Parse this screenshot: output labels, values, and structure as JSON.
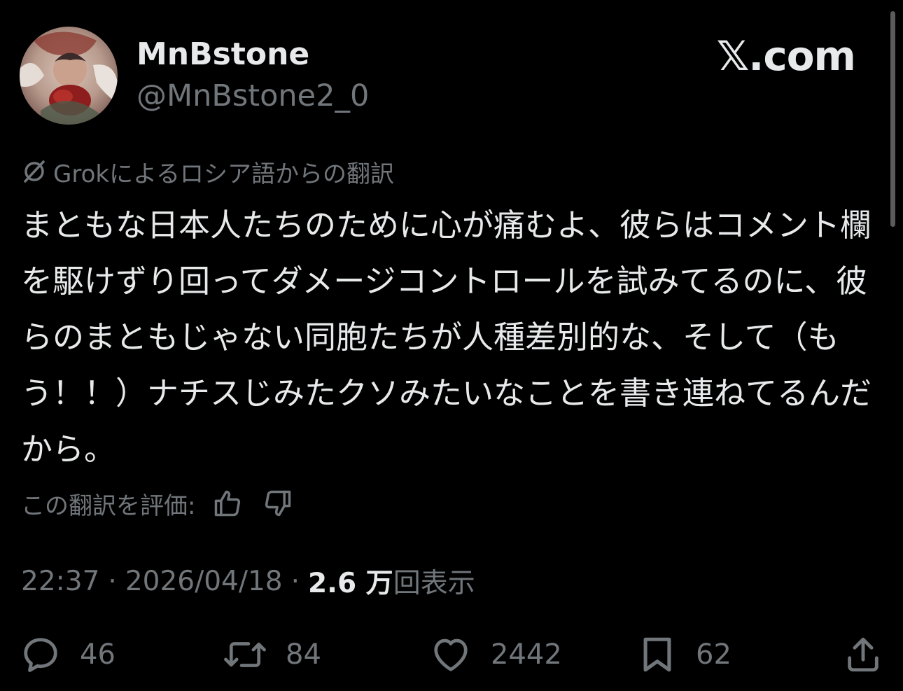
{
  "author": {
    "display_name": "MnBstone",
    "handle": "@MnBstone2_0"
  },
  "brand": "𝕏.com",
  "translation_note": "Grokによるロシア語からの翻訳",
  "tweet_text": "まともな日本人たちのために心が痛むよ、彼らはコメント欄を駆けずり回ってダメージコントロールを試みてるのに、彼らのまともじゃない同胞たちが人種差別的な、そして（もう！！）ナチスじみたクソみたいなことを書き連ねてるんだから。",
  "rate_translation": {
    "label": "この翻訳を評価:"
  },
  "meta": {
    "time": "22:37",
    "separator": "·",
    "date": "2026/04/18",
    "views_count": "2.6 万",
    "views_label": "回表示"
  },
  "actions": {
    "replies": "46",
    "reposts": "84",
    "likes": "2442",
    "bookmarks": "62"
  },
  "icons": {
    "translate": "translate-off-icon",
    "thumbs_up": "thumbs-up-icon",
    "thumbs_down": "thumbs-down-icon",
    "reply": "reply-bubble-icon",
    "repost": "repost-icon",
    "like": "heart-icon",
    "bookmark": "bookmark-icon",
    "share": "share-icon"
  },
  "colors": {
    "background": "#000000",
    "primary_text": "#e7e9ea",
    "secondary_text": "#71767b"
  }
}
